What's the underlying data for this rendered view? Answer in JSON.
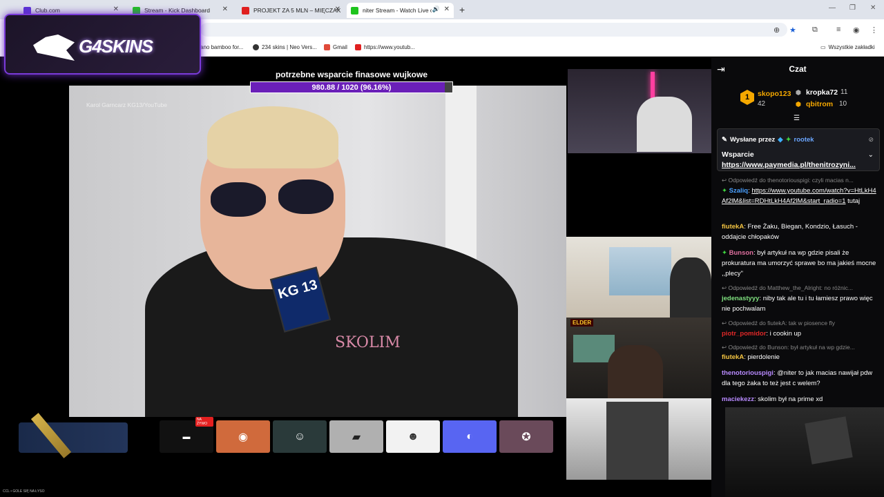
{
  "browser": {
    "tabs": [
      {
        "title": "Club.com",
        "color": "#5b33d6"
      },
      {
        "title": "Stream - Kick Dashboard",
        "color": "#1ec41e"
      },
      {
        "title": "PROJEKT ZA 5 MLN – MIĘCZAK",
        "color": "#e02020"
      },
      {
        "title": "niter Stream - Watch Live o",
        "color": "#1ec41e"
      }
    ],
    "bookmarks": [
      "ano bamboo for...",
      "234 skins | Neo Vers...",
      "Gmail",
      "https://www.youtub..."
    ],
    "all_bookmarks": "Wszystkie zakładki"
  },
  "overlay": {
    "logo_text": "G4SKINS",
    "goal_title": "potrzebne wsparcie finasowe wujkowe",
    "goal_value": "980.88 / 1020 (96.16%)",
    "goal_fraction": 0.9616,
    "source_label": "ŹRÓDŁO:",
    "source_text": "Karol Garncarz KG13/YouTube",
    "mic_label": "KG 13",
    "shirt_text": "SKOLIM",
    "pip_tag": "ELDER",
    "live_badge": "NA ŻYWO",
    "footer_text": "CCL • GOLE SIĘ NA ŁYSO"
  },
  "chat": {
    "title": "Czat",
    "leaderboard": [
      {
        "name": "skopo123",
        "count": "42",
        "color": "#f5a800",
        "rank": "1"
      },
      {
        "name": "kropka72",
        "count": "11",
        "color": "#ffffff"
      },
      {
        "name": "qbitrom",
        "count": "10",
        "color": "#f5a800"
      }
    ],
    "pinned": {
      "by_label": "Wysłane przez",
      "user": "rootek",
      "line1": "Wsparcie",
      "link": "https://www.paymedia.pl/thenitrozyni..."
    },
    "messages": [
      {
        "reply": "Odpowiedź do thenotoriouspigi: czyli macias n..."
      },
      {
        "user": "Szaliq",
        "color": "#4aa0ff",
        "text": "https://www.youtube.com/watch?v=HtLkH4Af2lM&list=RDHtLkH4Af2lM&start_radio=1",
        "tail": " tutaj"
      },
      {
        "user": "fiutekA",
        "color": "#f5c542",
        "text": "Free Żaku, Biegan, Kondzio, Łasuch - oddajcie chłopaków"
      },
      {
        "user": "Bunson",
        "color": "#e070a0",
        "text": "był artykuł na wp gdzie pisali że prokuratura ma umorzyć sprawe bo ma jakieś mocne ,,plecy''"
      },
      {
        "reply": "Odpowiedź do Matthew_the_Alright: no różnic..."
      },
      {
        "user": "jedenastyyy",
        "color": "#7fe07f",
        "text": "niby tak ale tu i tu łamiesz prawo więc nie pochwalam"
      },
      {
        "reply": "Odpowiedź do fiutekA: tak w piosence fly"
      },
      {
        "user": "piotr_pomidor",
        "color": "#e02828",
        "text": "i cookin up"
      },
      {
        "reply": "Odpowiedź do Bunson: był artykuł na wp gdzie..."
      },
      {
        "user": "fiutekA",
        "color": "#f5c542",
        "text": "pierdolenie"
      },
      {
        "user": "thenotoriouspigi",
        "color": "#b88aff",
        "text": "@niter to jak macias nawijał pdw dla tego żaka to też jest c welem?"
      },
      {
        "user": "maciekezz",
        "color": "#b88aff",
        "text": "skolim był na prime xd"
      }
    ]
  }
}
